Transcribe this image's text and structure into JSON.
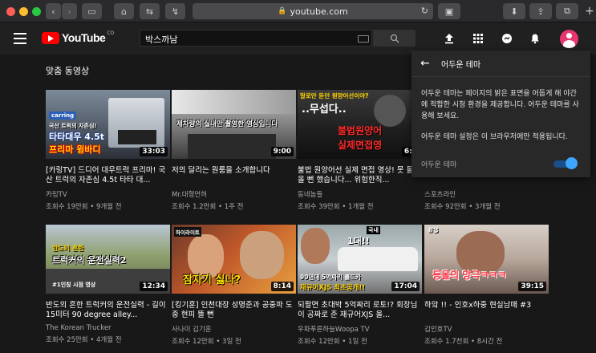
{
  "browser": {
    "url": "youtube.com",
    "traffic_colors": [
      "#ff5f57",
      "#febc2e",
      "#28c840"
    ]
  },
  "masthead": {
    "logo_text": "YouTube",
    "logo_sup": "CO",
    "search_value": "박스까남"
  },
  "section": {
    "title": "맞춤 동영상"
  },
  "videos": [
    {
      "title": "[카링TV] 드디어 대우트럭 프리마! 국산 트럭의 자존심 4.5t 타타 대...",
      "channel": "카링TV",
      "meta": "조회수 19만회 • 9개월 전",
      "duration": "33:03"
    },
    {
      "title": "저의 달리는 원룸을 소개합니다",
      "channel": "Mr.대형먼허",
      "meta": "조회수 1.2만회 • 1주 전",
      "duration": "9:00"
    },
    {
      "title": "불법 원양어선 실제 면접 영상! 못 돌아올 뻔 했습니다... 위험한직...",
      "channel": "동네놈들",
      "meta": "조회수 39만회 • 1개월 전",
      "duration": "6:5"
    },
    {
      "title": "",
      "channel": "스포츠라인",
      "meta": "조회수 92만회 • 3개월 전",
      "duration": ""
    },
    {
      "title": "반도의 흔한 트럭커의 운전실력 - 길이 15미터 90 degree alley...",
      "channel": "The Korean Trucker",
      "meta": "조회수 25만회 • 4개월 전",
      "duration": "12:34"
    },
    {
      "title": "[킹기훈] 인천대장 성명준과 공중파 도중 현피 뜰 뻔",
      "channel": "사나이 김기훈",
      "meta": "조회수 12만회 • 3일 전",
      "duration": "8:14"
    },
    {
      "title": "되팔면 초대박 5억짜리 로토!? 회장님이 공짜로 준 재규어XJS 올...",
      "channel": "우파푸른하늘Woopa TV",
      "meta": "조회수 12만회 • 1일 전",
      "duration": "17:04"
    },
    {
      "title": "하앜 !! - 인호x하중 현실남매 #3",
      "channel": "김인호TV",
      "meta": "조회수 1.7천회 • 8시간 전",
      "duration": "39:15"
    }
  ],
  "thumb_text": {
    "v0_brand": "carring",
    "v0_sub": "국산 트럭의 자존심!",
    "v0_main": "타타대우 4.5t",
    "v0_main2": "프리마 윙바디",
    "v1_main": "제차량의 실내만 촬영한 영상입니다",
    "v2_top": "말로만 듣던 원양어선이야?",
    "v2_mid": "..무섭다..",
    "v2_red": "불법원양어",
    "v2_red2": "실제면접영",
    "v4_top": "반도의 흔한",
    "v4_main": "트럭커의 운전실력2",
    "v4_bot": "#1인칭 시점 영상",
    "v5_tag": "하이라이트",
    "v5_main": "잠자기 싫나?",
    "v6_top": "국내",
    "v6_mid": "1대!!",
    "v6_a": "90년대 5억짜리 롤드카",
    "v6_b": "재규어XJS 최초공개!!",
    "v7_tag": "#3",
    "v7_main": "등몰의 앙극ㅋㅋㅋ"
  },
  "dark_theme_panel": {
    "title": "어두운 테마",
    "desc1": "어두운 테마는 페이지의 밝은 표면을 어둡게 해 야간에 적합한 시청 환경을 제공합니다. 어두운 테마를 사용해 보세요.",
    "desc2": "어두운 테마 설정은 이 브라우저에만 적용됩니다.",
    "toggle_label": "어두운 테마",
    "toggle_on": true
  }
}
